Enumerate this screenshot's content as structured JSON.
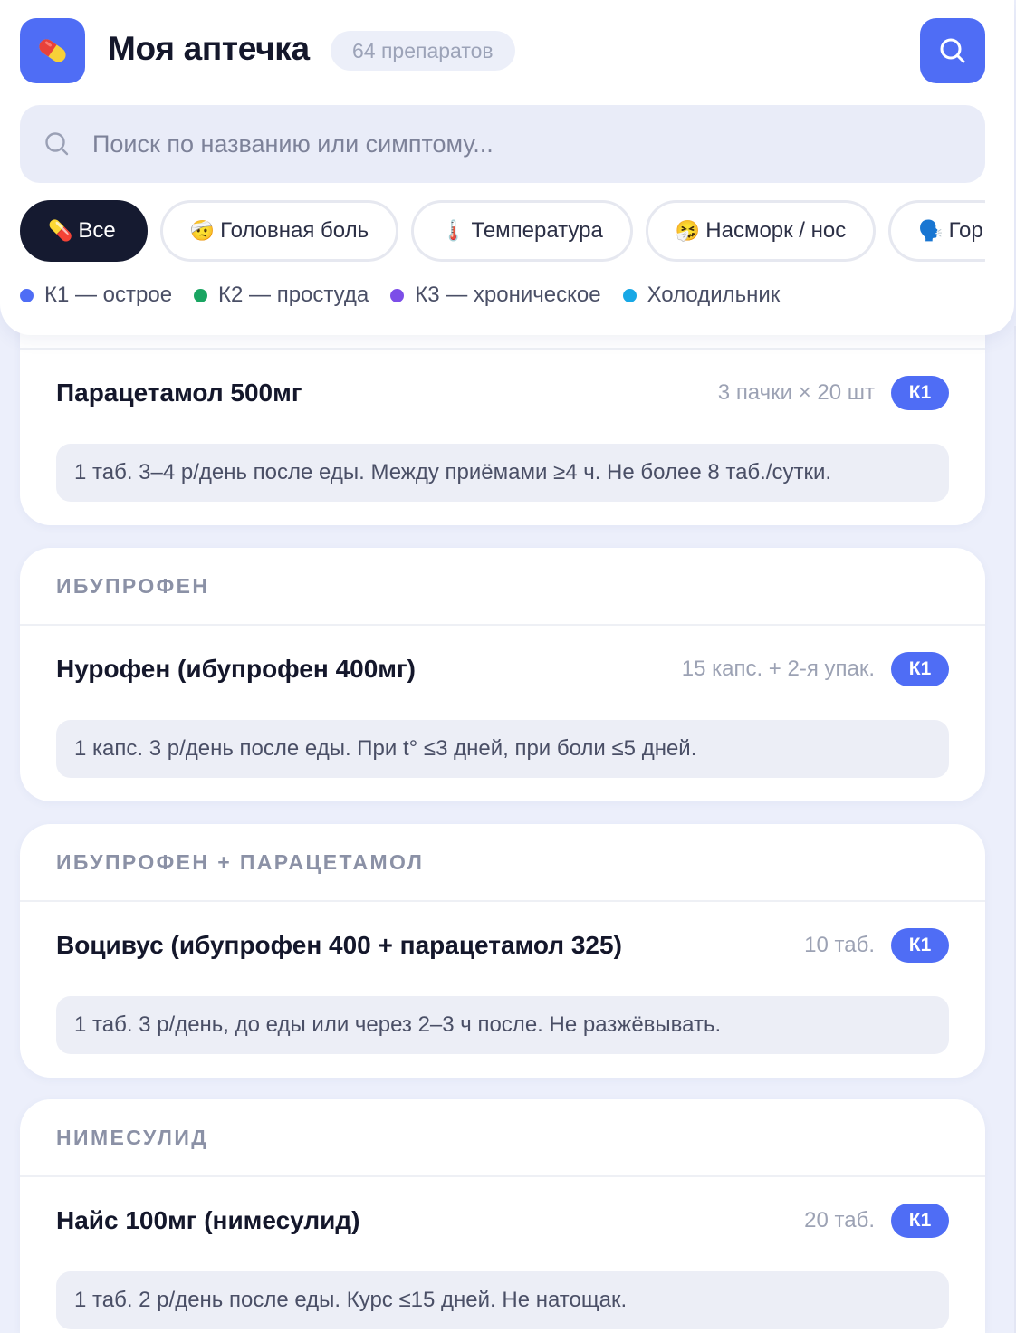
{
  "header": {
    "title": "Моя аптечка",
    "count_badge": "64 препаратов",
    "logo_icon": "pill-icon",
    "search_button_icon": "search-icon"
  },
  "search": {
    "placeholder": "Поиск по названию или симптому...",
    "value": ""
  },
  "chips": [
    {
      "emoji": "💊",
      "label": "Все",
      "active": true
    },
    {
      "emoji": "🤕",
      "label": "Головная боль",
      "active": false
    },
    {
      "emoji": "🌡️",
      "label": "Температура",
      "active": false
    },
    {
      "emoji": "🤧",
      "label": "Насморк / нос",
      "active": false
    },
    {
      "emoji": "🗣️",
      "label": "Гор",
      "active": false
    }
  ],
  "legend": [
    {
      "label": "К1 — острое",
      "color": "#4f6df5"
    },
    {
      "label": "К2 — простуда",
      "color": "#1aa562"
    },
    {
      "label": "К3 — хроническое",
      "color": "#7c4ee8"
    },
    {
      "label": "Холодильник",
      "color": "#18a8e6"
    }
  ],
  "cards": [
    {
      "category": "",
      "name": "Парацетамол 500мг",
      "quantity": "3 пачки × 20 шт",
      "badge": "К1",
      "dosage": "1 таб. 3–4 р/день после еды. Между приёмами ≥4 ч. Не более 8 таб./сутки."
    },
    {
      "category": "ИБУПРОФЕН",
      "name": "Нурофен (ибупрофен 400мг)",
      "quantity": "15 капс. + 2-я упак.",
      "badge": "К1",
      "dosage": "1 капс. 3 р/день после еды. При t° ≤3 дней, при боли ≤5 дней."
    },
    {
      "category": "ИБУПРОФЕН + ПАРАЦЕТАМОЛ",
      "name": "Воцивус (ибупрофен 400 + парацетамол 325)",
      "quantity": "10 таб.",
      "badge": "К1",
      "dosage": "1 таб. 3 р/день, до еды или через 2–3 ч после. Не разжёвывать."
    },
    {
      "category": "НИМЕСУЛИД",
      "name": "Найс 100мг (нимесулид)",
      "quantity": "20 таб.",
      "badge": "К1",
      "dosage": "1 таб. 2 р/день после еды. Курс ≤15 дней. Не натощак."
    }
  ],
  "colors": {
    "accent": "#4f6df5",
    "active_chip": "#151a30",
    "background": "#eceffb"
  }
}
